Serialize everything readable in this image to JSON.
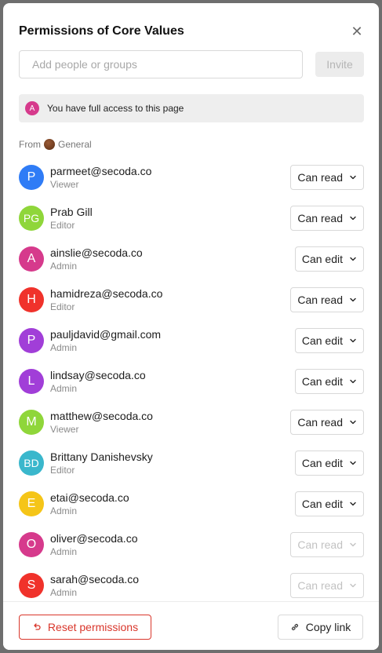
{
  "modal": {
    "title": "Permissions of Core Values",
    "close_icon": "close-icon"
  },
  "invite": {
    "placeholder": "Add people or groups",
    "button_label": "Invite"
  },
  "access_banner": {
    "avatar_initial": "A",
    "text": "You have full access to this page"
  },
  "group": {
    "from_label": "From",
    "name": "General"
  },
  "members": [
    {
      "initials": "P",
      "color": "#2f7cf6",
      "name": "parmeet@secoda.co",
      "role": "Viewer",
      "permission": "Can read",
      "disabled": false
    },
    {
      "initials": "PG",
      "color": "#8fd63a",
      "name": "Prab Gill",
      "role": "Editor",
      "permission": "Can read",
      "disabled": false
    },
    {
      "initials": "A",
      "color": "#d63a8c",
      "name": "ainslie@secoda.co",
      "role": "Admin",
      "permission": "Can edit",
      "disabled": false
    },
    {
      "initials": "H",
      "color": "#f0322b",
      "name": "hamidreza@secoda.co",
      "role": "Editor",
      "permission": "Can read",
      "disabled": false
    },
    {
      "initials": "P",
      "color": "#a13ed8",
      "name": "pauljdavid@gmail.com",
      "role": "Admin",
      "permission": "Can edit",
      "disabled": false
    },
    {
      "initials": "L",
      "color": "#a13ed8",
      "name": "lindsay@secoda.co",
      "role": "Admin",
      "permission": "Can edit",
      "disabled": false
    },
    {
      "initials": "M",
      "color": "#8fd63a",
      "name": "matthew@secoda.co",
      "role": "Viewer",
      "permission": "Can read",
      "disabled": false
    },
    {
      "initials": "BD",
      "color": "#3ab7cc",
      "name": "Brittany Danishevsky",
      "role": "Editor",
      "permission": "Can edit",
      "disabled": false
    },
    {
      "initials": "E",
      "color": "#f5c518",
      "name": "etai@secoda.co",
      "role": "Admin",
      "permission": "Can edit",
      "disabled": false
    },
    {
      "initials": "O",
      "color": "#d63a8c",
      "name": "oliver@secoda.co",
      "role": "Admin",
      "permission": "Can read",
      "disabled": true
    },
    {
      "initials": "S",
      "color": "#f0322b",
      "name": "sarah@secoda.co",
      "role": "Admin",
      "permission": "Can read",
      "disabled": true
    }
  ],
  "footer": {
    "reset_label": "Reset permissions",
    "copy_label": "Copy link"
  }
}
